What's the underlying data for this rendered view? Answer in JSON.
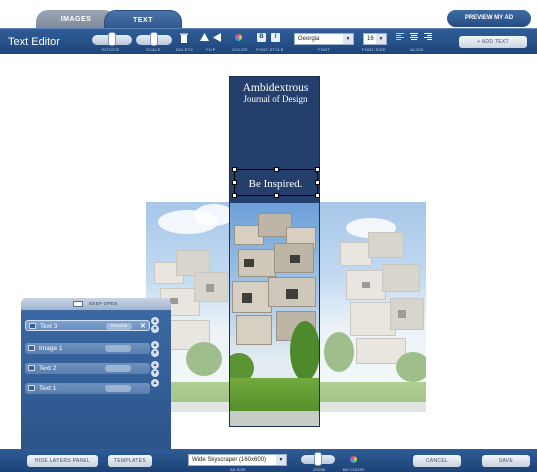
{
  "tabs": {
    "images": "IMAGES",
    "text": "TEXT"
  },
  "header": {
    "preview_label": "PREVIEW MY AD"
  },
  "toolbar": {
    "title": "Text Editor",
    "rotate_label": "ROTATE",
    "scale_label": "SCALE",
    "delete_label": "DELETE",
    "flip_label": "FLIP",
    "color_label": "COLOR",
    "font_style_label": "FONT-STYLE",
    "font_label": "FONT",
    "font_value": "Georgia",
    "font_size_label": "FONT-SIZE",
    "font_size_value": "16",
    "align_label": "ALIGN",
    "add_text_label": "ADD TEXT",
    "bold_glyph": "B",
    "italic_glyph": "I",
    "accent_color": "#2f5d97"
  },
  "ad": {
    "title": "Ambidextrous",
    "subtitle": "Journal of Design",
    "tagline": "Be Inspired."
  },
  "layers_panel": {
    "keep_open_label": "KEEP OPEN",
    "items": [
      {
        "label": "Text 3",
        "pill": "PREVIEW",
        "active": true
      },
      {
        "label": "Image 1",
        "pill": "",
        "active": false
      },
      {
        "label": "Text 2",
        "pill": "",
        "active": false
      },
      {
        "label": "Text 1",
        "pill": "",
        "active": false
      }
    ],
    "delete_glyph": "✕"
  },
  "bottombar": {
    "hide_layers_label": "HIDE LAYERS PANEL",
    "templates_label": "TEMPLATES",
    "ad_size_value": "Wide Skyscraper (160x600)",
    "ad_size_caption": "AD SIZE",
    "zoom_caption": "ZOOM",
    "bg_color_caption": "BG COLOR",
    "cancel_label": "CANCEL",
    "save_label": "SAVE"
  }
}
